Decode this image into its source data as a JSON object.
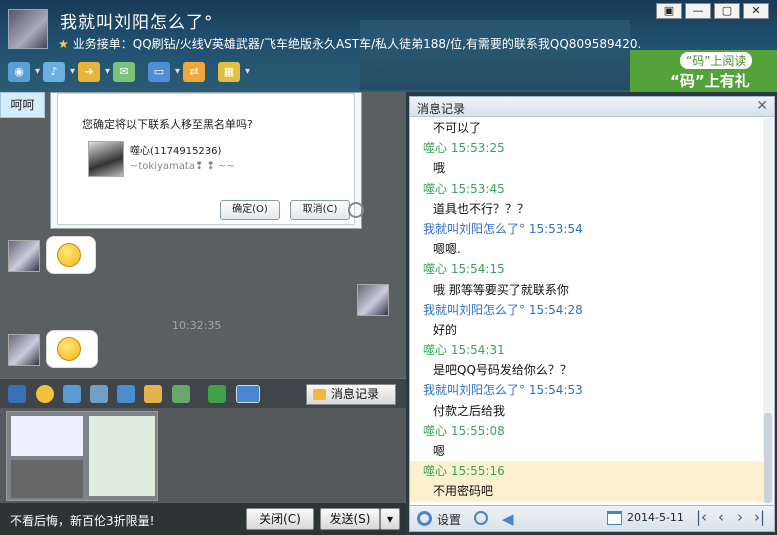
{
  "window": {
    "title": "我就叫刘阳怎么了°",
    "status": "业务接单：QQ刷钻/火线V英雄武器/飞车绝版永久AST车/私人徒弟188/位,有需要的联系我QQ809589420.",
    "controls": [
      "▣",
      "—",
      "▢",
      "✕"
    ]
  },
  "ad": {
    "line1": "“码”上阅读",
    "line2": "“码”上有礼"
  },
  "dialog": {
    "question": "您确定将以下联系人移至黑名单吗?",
    "contact_name": "噬心(1174915236)",
    "contact_signature": "~tokiyamata❢ ❢ ~~",
    "ok_label": "确定(O)",
    "cancel_label": "取消(C)"
  },
  "chat": {
    "bubble_text": "呵呵",
    "timestamp": "10:32:35"
  },
  "toolbar": {
    "history_label": "消息记录"
  },
  "bottom": {
    "promo": "不看后悔，新百伦3折限量!",
    "close_label": "关闭(C)",
    "send_label": "发送(S)",
    "send_arrow": "▾"
  },
  "history": {
    "title": "消息记录",
    "rows": [
      {
        "kind": "text",
        "text": "不可以了"
      },
      {
        "kind": "head",
        "color": "green",
        "text": "噬心 15:53:25"
      },
      {
        "kind": "text",
        "text": "哦"
      },
      {
        "kind": "head",
        "color": "green",
        "text": "噬心 15:53:45"
      },
      {
        "kind": "text",
        "text": "道具也不行？？？"
      },
      {
        "kind": "head",
        "color": "blue",
        "text": "我就叫刘阳怎么了° 15:53:54"
      },
      {
        "kind": "text",
        "text": "嗯嗯."
      },
      {
        "kind": "head",
        "color": "green",
        "text": "噬心 15:54:15"
      },
      {
        "kind": "text",
        "text": "哦  那等等要买了就联系你"
      },
      {
        "kind": "head",
        "color": "blue",
        "text": "我就叫刘阳怎么了° 15:54:28"
      },
      {
        "kind": "text",
        "text": "好的"
      },
      {
        "kind": "head",
        "color": "green",
        "text": "噬心 15:54:31"
      },
      {
        "kind": "text",
        "text": "是吧QQ号码发给你么？？"
      },
      {
        "kind": "head",
        "color": "blue",
        "text": "我就叫刘阳怎么了° 15:54:53"
      },
      {
        "kind": "text",
        "text": "付款之后给我"
      },
      {
        "kind": "head",
        "color": "green",
        "text": "噬心 15:55:08"
      },
      {
        "kind": "text",
        "text": "嗯"
      },
      {
        "kind": "head",
        "color": "green",
        "text": "噬心 15:55:16",
        "highlight": true
      },
      {
        "kind": "text",
        "text": "不用密码吧",
        "highlight": true
      }
    ],
    "settings_label": "设置",
    "date": "2014-5-11",
    "nav": [
      "|‹",
      "‹",
      "›",
      "›|"
    ]
  }
}
